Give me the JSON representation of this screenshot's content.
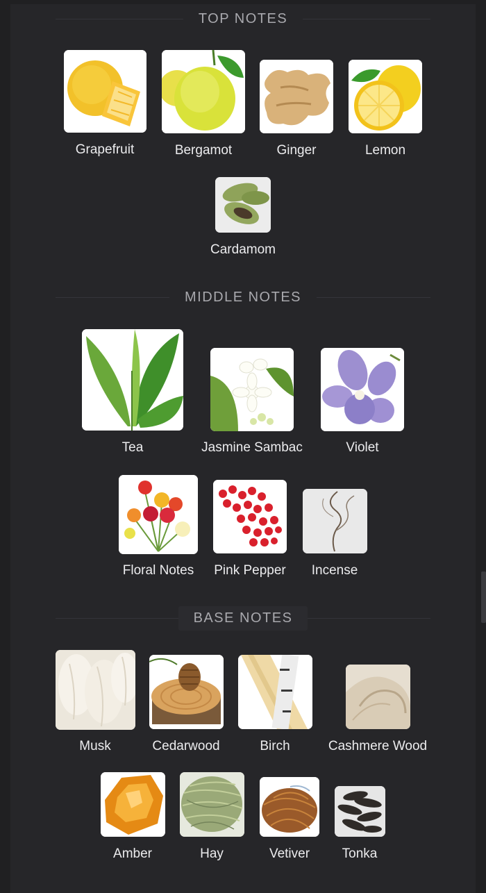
{
  "sections": {
    "top": {
      "title": "TOP NOTES",
      "notes": [
        "Grapefruit",
        "Bergamot",
        "Ginger",
        "Lemon",
        "Cardamom"
      ]
    },
    "middle": {
      "title": "MIDDLE NOTES",
      "notes": [
        "Tea",
        "Jasmine Sambac",
        "Violet",
        "Floral Notes",
        "Pink Pepper",
        "Incense"
      ]
    },
    "base": {
      "title": "BASE NOTES",
      "notes": [
        "Musk",
        "Cedarwood",
        "Birch",
        "Cashmere Wood",
        "Amber",
        "Hay",
        "Vetiver",
        "Tonka"
      ]
    }
  },
  "colors": {
    "page_bg": "#202022",
    "panel_bg": "#262629",
    "header_text": "#a9a9ae",
    "label_text": "#ececee"
  },
  "icons": {
    "grapefruit": "grapefruit-icon",
    "bergamot": "bergamot-icon",
    "ginger": "ginger-icon",
    "lemon": "lemon-icon",
    "cardamom": "cardamom-icon",
    "tea": "tea-leaf-icon",
    "jasmine": "jasmine-flower-icon",
    "violet": "violet-flower-icon",
    "floral": "bouquet-icon",
    "pink_pepper": "pink-pepper-icon",
    "incense": "incense-smoke-icon",
    "musk": "musk-fur-icon",
    "cedarwood": "cedarwood-icon",
    "birch": "birch-icon",
    "cashmere": "cashmere-fabric-icon",
    "amber": "amber-icon",
    "hay": "hay-icon",
    "vetiver": "vetiver-icon",
    "tonka": "tonka-bean-icon"
  }
}
